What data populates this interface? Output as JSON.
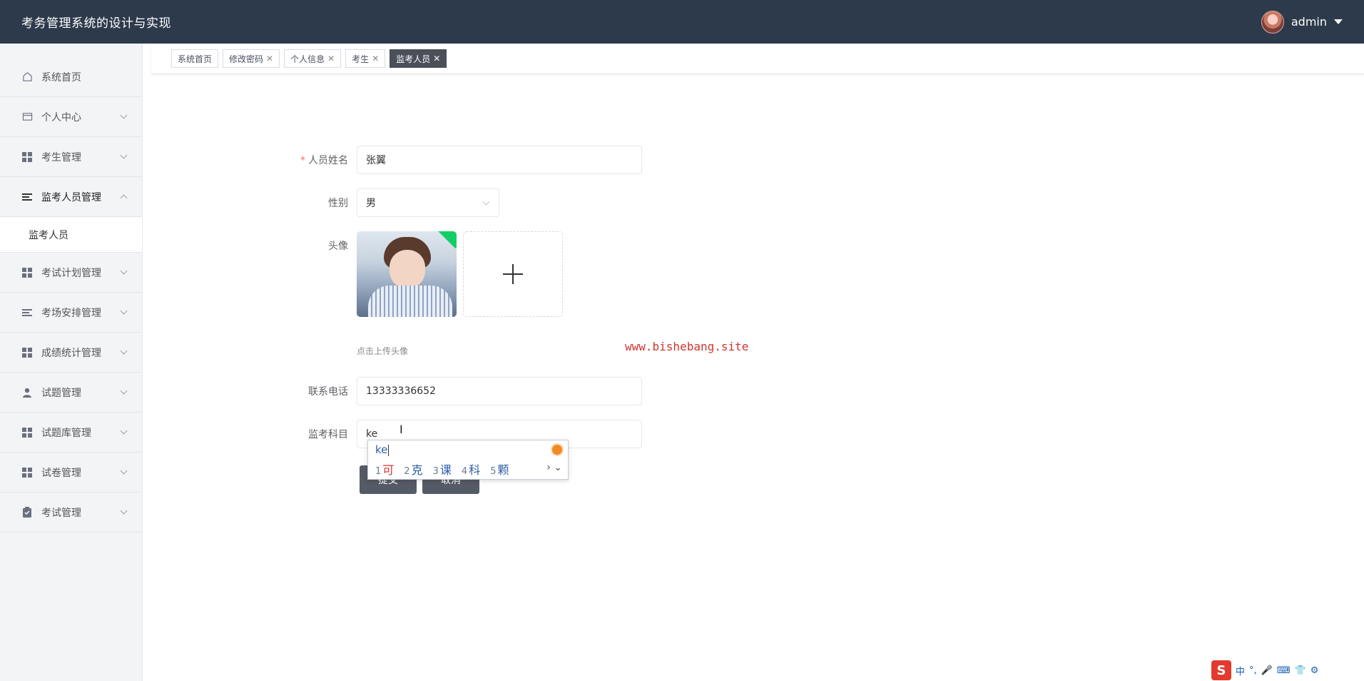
{
  "header": {
    "title": "考务管理系统的设计与实现",
    "username": "admin"
  },
  "sidebar": {
    "items": [
      {
        "label": "系统首页",
        "icon": "home-icon"
      },
      {
        "label": "个人中心",
        "icon": "card-icon"
      },
      {
        "label": "考生管理",
        "icon": "grid-icon"
      },
      {
        "label": "监考人员管理",
        "icon": "list-icon"
      },
      {
        "label": "考试计划管理",
        "icon": "grid-icon"
      },
      {
        "label": "考场安排管理",
        "icon": "list-icon"
      },
      {
        "label": "成绩统计管理",
        "icon": "grid-icon"
      },
      {
        "label": "试题管理",
        "icon": "user-icon"
      },
      {
        "label": "试题库管理",
        "icon": "grid-icon"
      },
      {
        "label": "试卷管理",
        "icon": "grid-icon"
      },
      {
        "label": "考试管理",
        "icon": "clipboard-icon"
      }
    ],
    "open_sub": {
      "label": "监考人员"
    }
  },
  "tabs": [
    {
      "label": "系统首页",
      "closable": false
    },
    {
      "label": "修改密码",
      "closable": true
    },
    {
      "label": "个人信息",
      "closable": true
    },
    {
      "label": "考生",
      "closable": true
    },
    {
      "label": "监考人员",
      "closable": true,
      "active": true
    }
  ],
  "form": {
    "name": {
      "label": "人员姓名",
      "value": "张翼",
      "required_mark": "*"
    },
    "gender": {
      "label": "性别",
      "value": "男"
    },
    "avatar": {
      "label": "头像",
      "tip": "点击上传头像"
    },
    "phone": {
      "label": "联系电话",
      "value": "13333336652"
    },
    "subject": {
      "label": "监考科目",
      "value": "ke"
    },
    "submit_label": "提交",
    "cancel_label": "取消"
  },
  "watermark": "www.bishebang.site",
  "ime": {
    "composition": "ke",
    "candidates": [
      {
        "n": "1",
        "text": "可"
      },
      {
        "n": "2",
        "text": "克"
      },
      {
        "n": "3",
        "text": "课"
      },
      {
        "n": "4",
        "text": "科"
      },
      {
        "n": "5",
        "text": "颗"
      }
    ]
  },
  "tray": {
    "sogou": "S",
    "mode": "中"
  },
  "colors": {
    "header_bg": "#2d3a4b",
    "sidebar_bg": "#f3f4f6",
    "active_tab": "#4a4f59",
    "button": "#555b66",
    "watermark": "#d0342c"
  }
}
